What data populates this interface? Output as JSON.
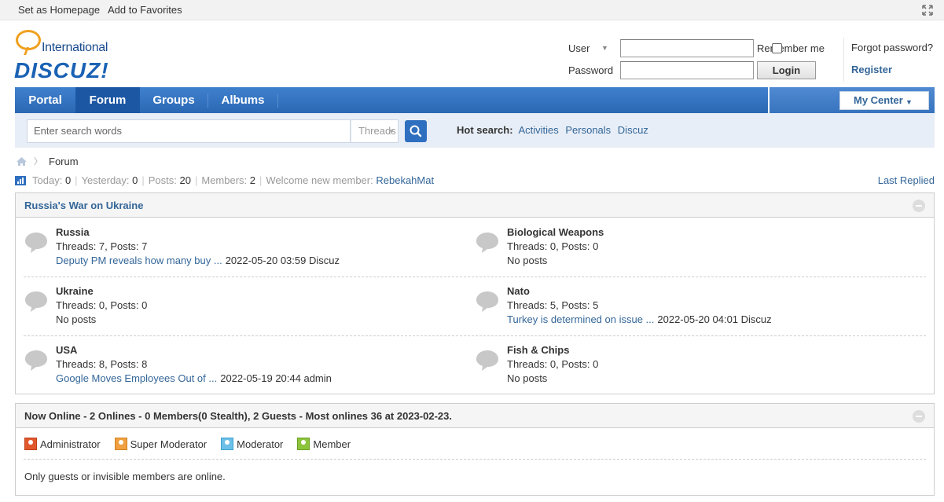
{
  "topbar": {
    "set_homepage": "Set as Homepage",
    "add_favorites": "Add to Favorites"
  },
  "logo": {
    "intl": "International",
    "brand": "DISCUZ!"
  },
  "login": {
    "user_label": "User",
    "password_label": "Password",
    "user_value": "",
    "password_value": "",
    "remember_label": "Remember me",
    "login_button": "Login",
    "forgot": "Forgot password?",
    "register": "Register"
  },
  "nav": {
    "items": [
      {
        "label": "Portal"
      },
      {
        "label": "Forum"
      },
      {
        "label": "Groups"
      },
      {
        "label": "Albums"
      }
    ],
    "active": "Forum",
    "my_center": "My Center"
  },
  "search": {
    "placeholder": "Enter search words",
    "type": "Threads",
    "hot_label": "Hot search:",
    "hot_terms": [
      "Activities",
      "Personals",
      "Discuz"
    ]
  },
  "breadcrumb": {
    "current": "Forum"
  },
  "stats": {
    "today_label": "Today:",
    "today": "0",
    "yesterday_label": "Yesterday:",
    "yesterday": "0",
    "posts_label": "Posts:",
    "posts": "20",
    "members_label": "Members:",
    "members": "2",
    "welcome_label": "Welcome new member:",
    "new_member": "RebekahMat",
    "last_replied": "Last Replied"
  },
  "category": {
    "title": "Russia's War on Ukraine",
    "forums": [
      {
        "name": "Russia",
        "stats": "Threads: 7, Posts: 7",
        "last_title": "Deputy PM reveals how many buy ...",
        "last_meta": "2022-05-20 03:59 Discuz"
      },
      {
        "name": "Biological Weapons",
        "stats": "Threads: 0, Posts: 0",
        "last_title": "",
        "last_meta": "No posts"
      },
      {
        "name": "Ukraine",
        "stats": "Threads: 0, Posts: 0",
        "last_title": "",
        "last_meta": "No posts"
      },
      {
        "name": "Nato",
        "stats": "Threads: 5, Posts: 5",
        "last_title": "Turkey is determined on issue ...",
        "last_meta": "2022-05-20 04:01 Discuz"
      },
      {
        "name": "USA",
        "stats": "Threads: 8, Posts: 8",
        "last_title": "Google Moves Employees Out of ...",
        "last_meta": "2022-05-19 20:44 admin"
      },
      {
        "name": "Fish & Chips",
        "stats": "Threads: 0, Posts: 0",
        "last_title": "",
        "last_meta": "No posts"
      }
    ]
  },
  "online": {
    "title": "Now Online - 2 Onlines - 0 Members(0 Stealth), 2 Guests - Most onlines 36 at 2023-02-23.",
    "legend": [
      {
        "label": "Administrator",
        "color": "#e0582c"
      },
      {
        "label": "Super Moderator",
        "color": "#f0a040"
      },
      {
        "label": "Moderator",
        "color": "#6cc0e8"
      },
      {
        "label": "Member",
        "color": "#8cc43c"
      }
    ],
    "message": "Only guests or invisible members are online."
  },
  "colors": {
    "nav_blue": "#2b68b4",
    "nav_active": "#1c57a4",
    "link": "#336699",
    "search_bg": "#e8eef7"
  }
}
